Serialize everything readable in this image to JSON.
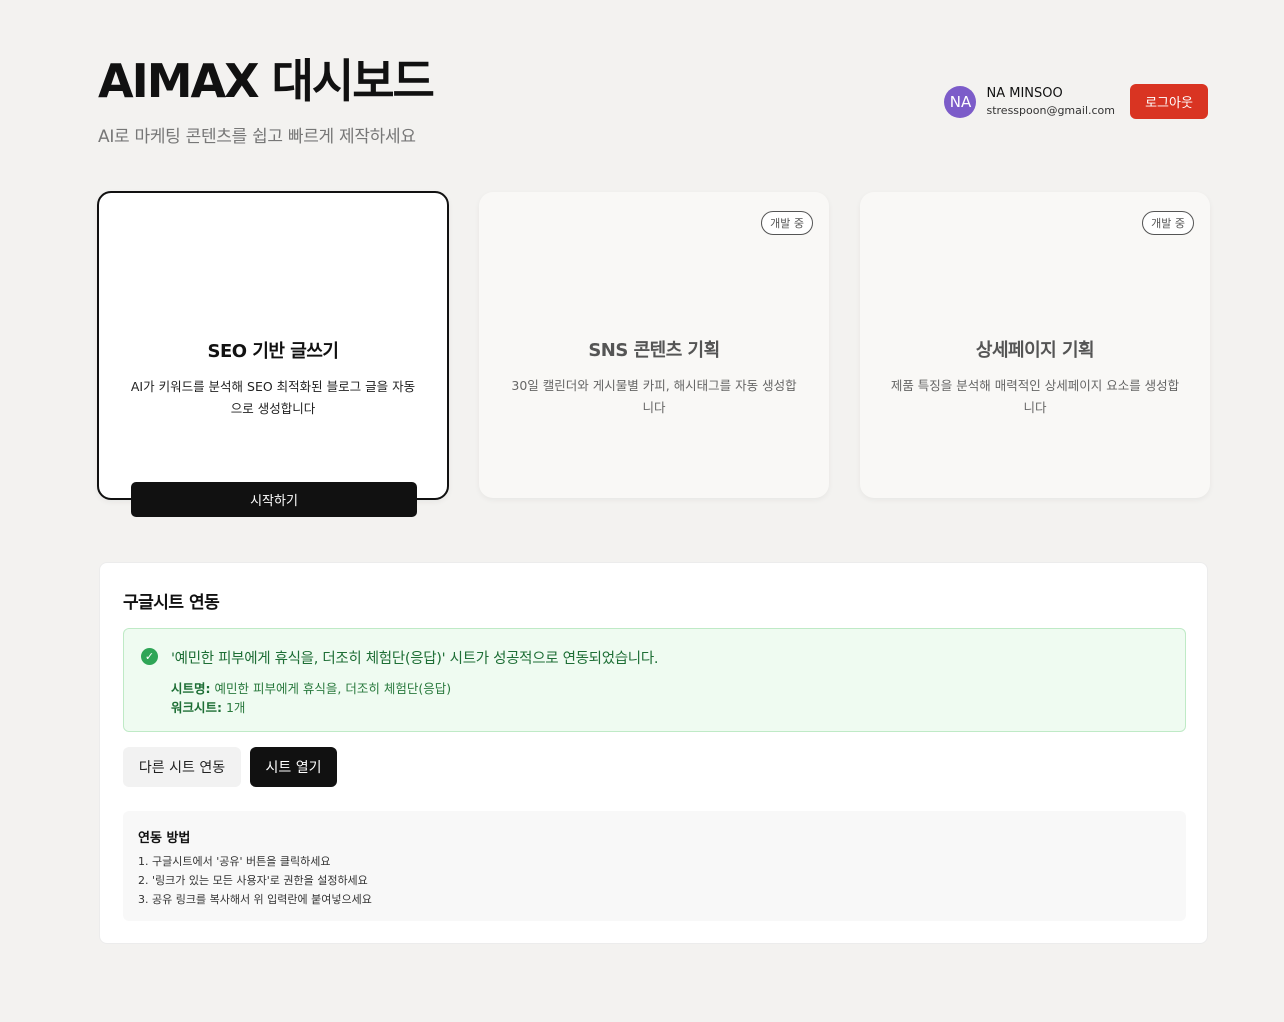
{
  "header": {
    "title": "AIMAX 대시보드",
    "subtitle": "AI로 마케팅 콘텐츠를 쉽고 빠르게 제작하세요"
  },
  "user": {
    "initials": "NA",
    "name": "NA MINSOO",
    "email": "stresspoon@gmail.com",
    "logout_label": "로그아웃"
  },
  "cards": [
    {
      "title": "SEO 기반 글쓰기",
      "desc": "AI가 키워드를 분석해 SEO 최적화된 블로그 글을 자동으로 생성합니다",
      "button": "시작하기"
    },
    {
      "title": "SNS 콘텐츠 기획",
      "desc": "30일 캘린더와 게시물별 카피, 해시태그를 자동 생성합니다",
      "badge": "개발 중"
    },
    {
      "title": "상세페이지 기획",
      "desc": "제품 특징을 분석해 매력적인 상세페이지 요소를 생성합니다",
      "badge": "개발 중"
    }
  ],
  "sheet": {
    "title": "구글시트 연동",
    "success_message": "'예민한 피부에게 휴식을, 더조히 체험단(응답)' 시트가 성공적으로 연동되었습니다.",
    "sheet_name_label": "시트명:",
    "sheet_name": "예민한 피부에게 휴식을, 더조히 체험단(응답)",
    "worksheet_label": "워크시트:",
    "worksheet_count": "1개",
    "other_button": "다른 시트 연동",
    "open_button": "시트 열기",
    "howto_title": "연동 방법",
    "howto_steps": [
      "1. 구글시트에서 '공유' 버튼을 클릭하세요",
      "2. '링크가 있는 모든 사용자'로 권한을 설정하세요",
      "3. 공유 링크를 복사해서 위 입력란에 붙여넣으세요"
    ]
  },
  "colors": {
    "accent_red": "#d93422",
    "avatar_purple": "#7c5cc9",
    "success_green": "#2fa557"
  }
}
